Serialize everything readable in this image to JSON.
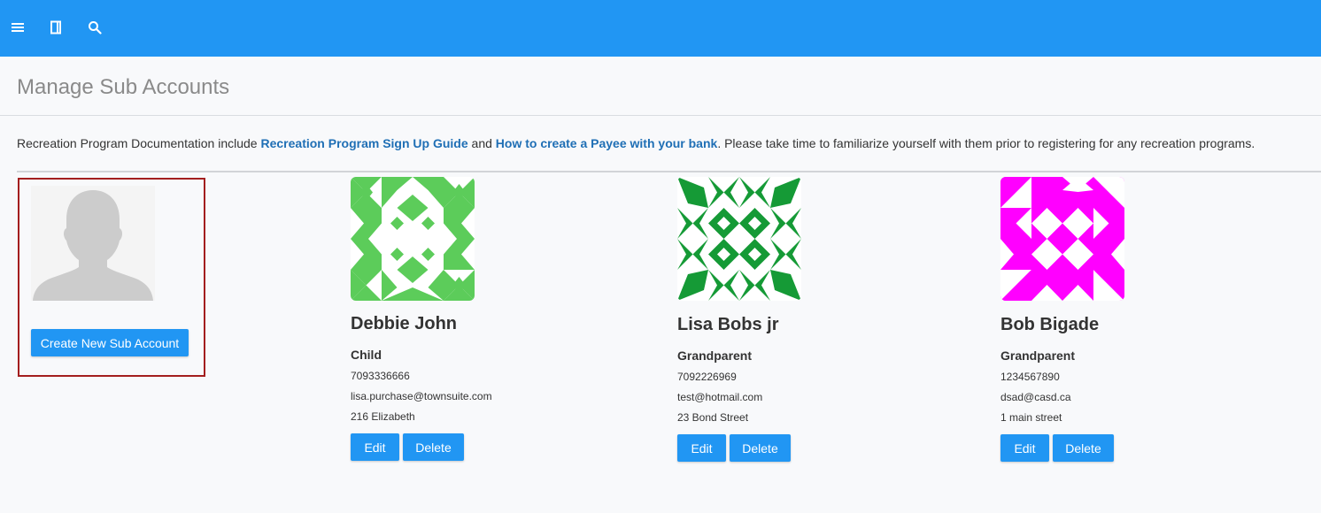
{
  "topbar": {
    "icons": [
      "menu-icon",
      "book-icon",
      "search-icon"
    ],
    "color": "#2196f3"
  },
  "page": {
    "title": "Manage Sub Accounts"
  },
  "doc_notice": {
    "prefix": "Recreation Program Documentation include ",
    "link1": "Recreation Program Sign Up Guide",
    "middle": " and ",
    "link2": "How to create a Payee with your bank",
    "suffix": ". Please take time to familiarize yourself with them prior to registering for any recreation programs."
  },
  "create": {
    "button_label": "Create New Sub Account"
  },
  "accounts": [
    {
      "name": "Debbie John",
      "relation": "Child",
      "phone": "7093336666",
      "email": "lisa.purchase@townsuite.com",
      "address": "216 Elizabeth",
      "avatar_color": "#5ccc5a",
      "edit_label": "Edit",
      "delete_label": "Delete"
    },
    {
      "name": "Lisa Bobs jr",
      "relation": "Grandparent",
      "phone": "7092226969",
      "email": "test@hotmail.com",
      "address": "23 Bond Street",
      "avatar_color": "#159a36",
      "edit_label": "Edit",
      "delete_label": "Delete"
    },
    {
      "name": "Bob Bigade",
      "relation": "Grandparent",
      "phone": "1234567890",
      "email": "dsad@casd.ca",
      "address": "1 main street",
      "avatar_color": "#ff00ff",
      "edit_label": "Edit",
      "delete_label": "Delete"
    }
  ]
}
